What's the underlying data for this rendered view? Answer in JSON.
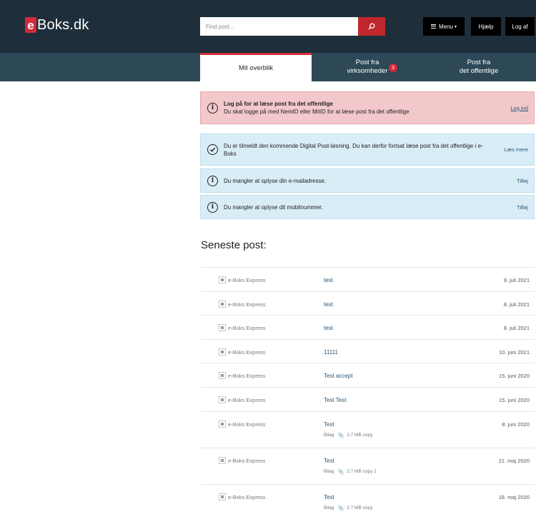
{
  "header": {
    "logo_e": "e",
    "logo_text": "Boks.dk",
    "search_placeholder": "Find post...",
    "menu_label": "Menu",
    "help_label": "Hjælp",
    "logout_label": "Log af"
  },
  "tabs": [
    {
      "line1": "Mit overblik",
      "line2": ""
    },
    {
      "line1": "Post fra",
      "line2": "virksomheder",
      "badge": "3"
    },
    {
      "line1": "Post fra",
      "line2": "det offentlige"
    }
  ],
  "alerts": {
    "login": {
      "title": "Log på for at læse post fra det offentlige",
      "text": "Du skal logge på med NemID eller MitID for at læse post fra det offentlige",
      "link": "Log ind"
    },
    "digital_post": {
      "text": "Du er tilmeldt den kommende Digital Post-løsning. Du kan derfor fortsat læse post fra det offentlige i e-Boks",
      "link": "Læs mere"
    },
    "email": {
      "text": "Du mangler at oplyse din e-mailadresse.",
      "link": "Tilføj"
    },
    "mobile": {
      "text": "Du mangler at oplyse dit mobilnummer.",
      "link": "Tilføj"
    }
  },
  "seneste": {
    "title": "Seneste post:",
    "items": [
      {
        "sender": "e-Boks Express",
        "subject": "test",
        "date": "9. juli 2021"
      },
      {
        "sender": "e-Boks Express",
        "subject": "test",
        "date": "8. juli 2021"
      },
      {
        "sender": "e-Boks Express",
        "subject": "test",
        "date": "8. juli 2021"
      },
      {
        "sender": "e-Boks Express",
        "subject": "11111",
        "date": "10. juni 2021"
      },
      {
        "sender": "e-Boks Express",
        "subject": "Test accept",
        "date": "15. juni 2020"
      },
      {
        "sender": "e-Boks Express",
        "subject": "Test Test",
        "date": "15. juni 2020"
      },
      {
        "sender": "e-Boks Express",
        "subject": "Test",
        "date": "8. juni 2020",
        "meta_label": "Bilag",
        "attachment": "2.7 MB copy"
      },
      {
        "sender": "e-Boks Express",
        "subject": "Test",
        "date": "21. maj 2020",
        "meta_label": "Bilag",
        "attachment": "2.7 MB copy 2"
      },
      {
        "sender": "e-Boks Express",
        "subject": "Test",
        "date": "18. maj 2020",
        "meta_label": "Bilag",
        "attachment": "2.7 MB copy"
      }
    ]
  },
  "colors": {
    "topbar": "#1e2f3b",
    "navbar": "#2d4856",
    "accent": "#d22b3b",
    "link": "#2a5675"
  }
}
